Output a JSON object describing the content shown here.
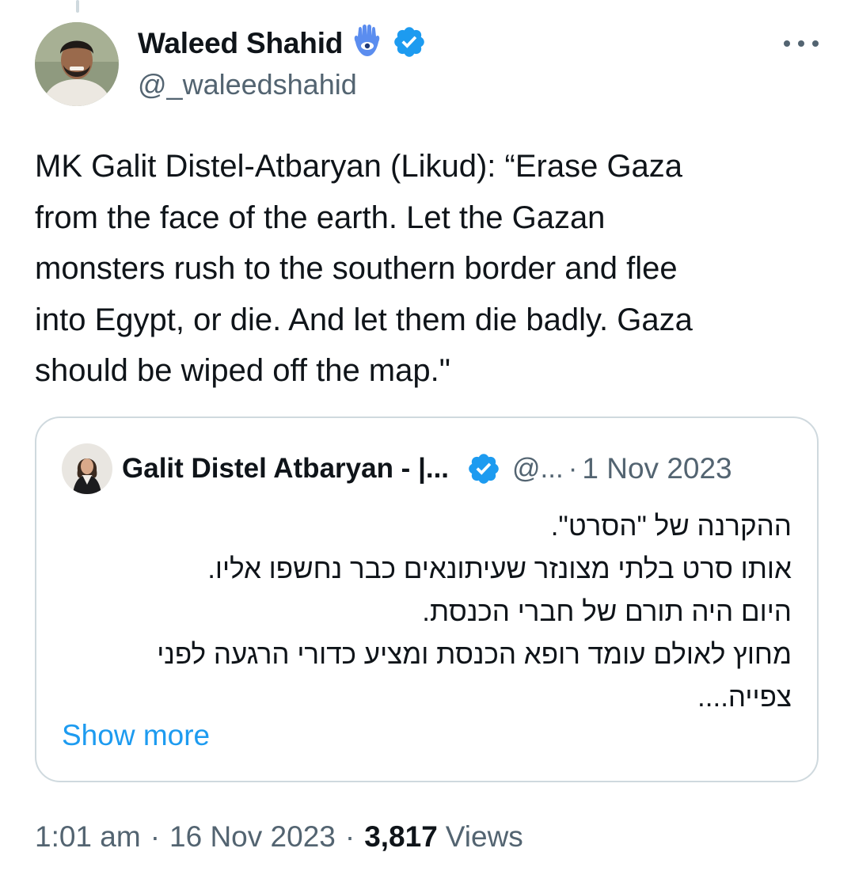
{
  "author": {
    "display_name": "Waleed Shahid",
    "handle": "@_waleedshahid",
    "emoji_icon": "hamsa-icon",
    "verified_icon": "verified-badge-icon"
  },
  "tweet": {
    "text": "MK Galit Distel-Atbaryan (Likud): “Erase Gaza\nfrom the face of the earth. Let the Gazan\nmonsters rush to the southern border and flee\ninto Egypt, or die. And let them die badly. Gaza\nshould be wiped off the map.\""
  },
  "quote": {
    "display_name": "Galit Distel Atbaryan - |...",
    "handle": "@...",
    "separator": "·",
    "date": "1 Nov 2023",
    "text": "ההקרנה של \"הסרט\".\nאותו סרט בלתי מצונזר שעיתונאים כבר נחשפו אליו.\nהיום היה תורם של חברי הכנסת.\nמחוץ לאולם עומד רופא הכנסת ומציע כדורי הרגעה לפני\nצפייה....",
    "show_more": "Show more"
  },
  "meta": {
    "time": "1:01 am",
    "separator": "·",
    "date": "16 Nov 2023",
    "views_count": "3,817",
    "views_label": "Views"
  },
  "colors": {
    "accent": "#1d9bf0",
    "text_primary": "#0f1419",
    "text_secondary": "#536471",
    "border": "#cfd9de"
  }
}
